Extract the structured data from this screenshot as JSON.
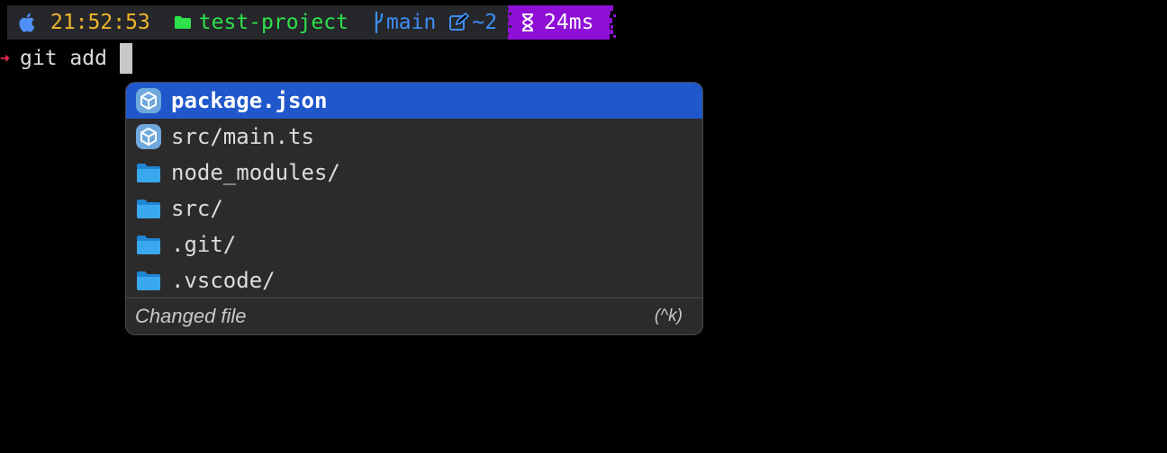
{
  "status_bar": {
    "os_icon": "apple-logo-icon",
    "time": "21:52:53",
    "folder_icon": "folder-icon",
    "project": "test-project",
    "branch_icon": "git-branch-icon",
    "branch": "main",
    "changes_icon": "edit-icon",
    "changes": "~2",
    "duration_icon": "hourglass-icon",
    "duration": "24ms",
    "colors": {
      "segment_bg": "#26272b",
      "time": "#f0b52a",
      "project": "#2ee14a",
      "git": "#3e8ff5",
      "duration_bg": "#8f0fd6",
      "prompt_arrow": "#ff2e55"
    }
  },
  "command_line": {
    "prompt_icon": "arrow-right-icon",
    "prompt_arrow": "➜",
    "command": "git add"
  },
  "completion_menu": {
    "items": [
      {
        "label": "package.json",
        "icon": "package-icon",
        "selected": true
      },
      {
        "label": "src/main.ts",
        "icon": "package-icon",
        "selected": false
      },
      {
        "label": "node_modules/",
        "icon": "folder-icon",
        "selected": false
      },
      {
        "label": "src/",
        "icon": "folder-icon",
        "selected": false
      },
      {
        "label": ".git/",
        "icon": "folder-icon",
        "selected": false
      },
      {
        "label": ".vscode/",
        "icon": "folder-icon",
        "selected": false
      }
    ],
    "footer_label": "Changed file",
    "footer_shortcut": "(^k)",
    "colors": {
      "background": "#2b2b2b",
      "selected_bg": "#2058cb",
      "folder": "#3aa8ee",
      "package": "#6fa8dc"
    }
  }
}
